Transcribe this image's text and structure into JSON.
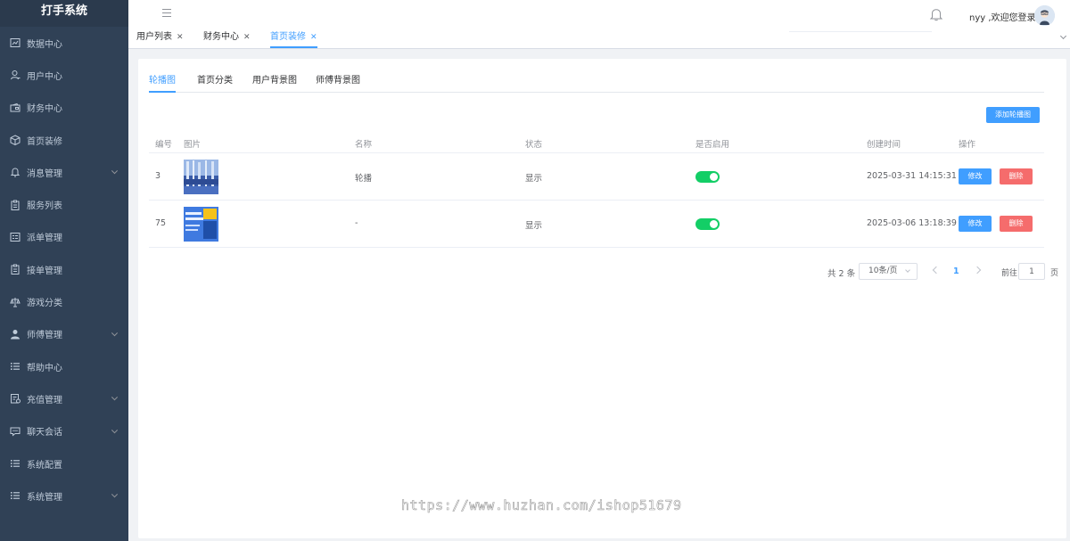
{
  "app": {
    "title": "打手系统"
  },
  "sidebar": {
    "items": [
      {
        "label": "数据中心",
        "icon": "chart-icon",
        "has_arrow": false
      },
      {
        "label": "用户中心",
        "icon": "user-icon",
        "has_arrow": false
      },
      {
        "label": "财务中心",
        "icon": "wallet-icon",
        "has_arrow": false
      },
      {
        "label": "首页装修",
        "icon": "cube-icon",
        "has_arrow": false
      },
      {
        "label": "消息管理",
        "icon": "bell-icon",
        "has_arrow": true
      },
      {
        "label": "服务列表",
        "icon": "clipboard-icon",
        "has_arrow": false
      },
      {
        "label": "派单管理",
        "icon": "list-box-icon",
        "has_arrow": false
      },
      {
        "label": "接单管理",
        "icon": "clipboard-icon",
        "has_arrow": false
      },
      {
        "label": "游戏分类",
        "icon": "scale-icon",
        "has_arrow": false
      },
      {
        "label": "师傅管理",
        "icon": "person-icon",
        "has_arrow": true
      },
      {
        "label": "帮助中心",
        "icon": "lines-icon",
        "has_arrow": false
      },
      {
        "label": "充值管理",
        "icon": "receipt-icon",
        "has_arrow": true
      },
      {
        "label": "聊天会话",
        "icon": "chat-icon",
        "has_arrow": true
      },
      {
        "label": "系统配置",
        "icon": "lines-icon",
        "has_arrow": false
      },
      {
        "label": "系统管理",
        "icon": "lines-icon",
        "has_arrow": true
      }
    ]
  },
  "header": {
    "welcome": "nyy ,欢迎您登录"
  },
  "tags": [
    {
      "label": "用户列表",
      "active": false
    },
    {
      "label": "财务中心",
      "active": false
    },
    {
      "label": "首页装修",
      "active": true
    }
  ],
  "tabs": [
    {
      "label": "轮播图",
      "active": true
    },
    {
      "label": "首页分类",
      "active": false
    },
    {
      "label": "用户背景图",
      "active": false
    },
    {
      "label": "师傅背景图",
      "active": false
    }
  ],
  "toolbar": {
    "add_label": "添加轮播图"
  },
  "table": {
    "columns": [
      "编号",
      "图片",
      "名称",
      "状态",
      "是否启用",
      "创建时间",
      "操作"
    ],
    "rows": [
      {
        "id": "3",
        "name": "轮播",
        "status": "显示",
        "enabled": true,
        "created": "2025-03-31 14:15:31",
        "edit": "修改",
        "delete": "删除"
      },
      {
        "id": "75",
        "name": "-",
        "status": "显示",
        "enabled": true,
        "created": "2025-03-06 13:18:39",
        "edit": "修改",
        "delete": "删除"
      }
    ]
  },
  "pagination": {
    "total": "共 2 条",
    "page_size": "10条/页",
    "current": "1",
    "goto_label": "前往",
    "goto_value": "1",
    "unit": "页"
  },
  "watermark": "https://www.huzhan.com/ishop51679",
  "colors": {
    "sidebar": "#304156",
    "primary": "#409eff",
    "danger": "#f56c6c",
    "switch_on": "#13ce66"
  }
}
